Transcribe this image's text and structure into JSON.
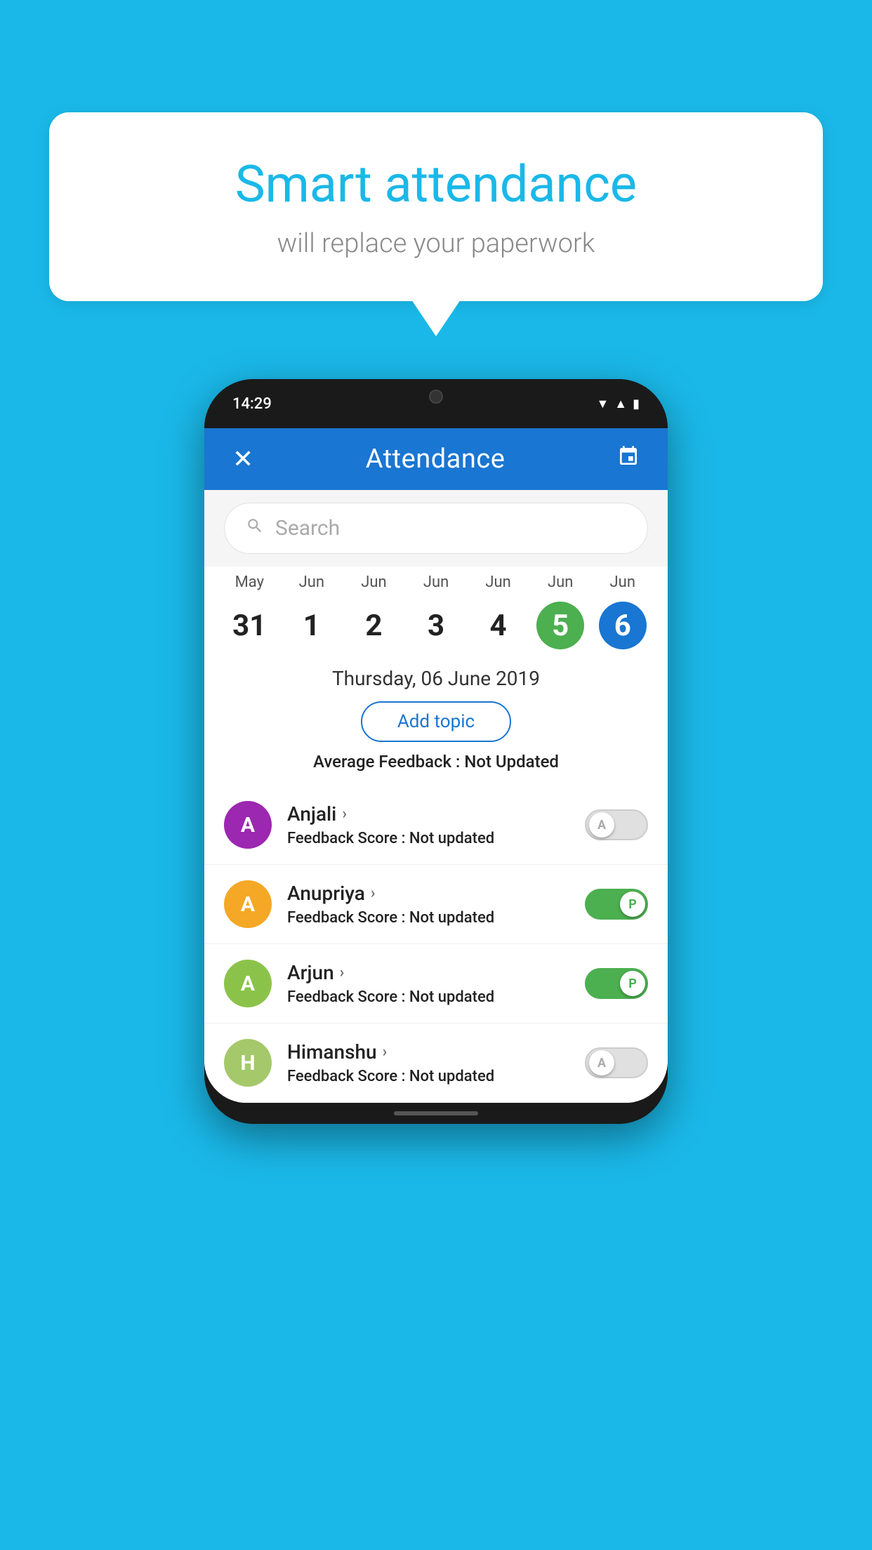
{
  "background_color": "#1ab8e8",
  "speech_bubble": {
    "title": "Smart attendance",
    "subtitle": "will replace your paperwork"
  },
  "phone": {
    "status_bar": {
      "time": "14:29"
    },
    "header": {
      "title": "Attendance",
      "close_icon": "✕",
      "calendar_icon": "📅"
    },
    "search": {
      "placeholder": "Search"
    },
    "calendar": {
      "columns": [
        {
          "month": "May",
          "day": "31",
          "style": "normal"
        },
        {
          "month": "Jun",
          "day": "1",
          "style": "normal"
        },
        {
          "month": "Jun",
          "day": "2",
          "style": "normal"
        },
        {
          "month": "Jun",
          "day": "3",
          "style": "normal"
        },
        {
          "month": "Jun",
          "day": "4",
          "style": "normal"
        },
        {
          "month": "Jun",
          "day": "5",
          "style": "today"
        },
        {
          "month": "Jun",
          "day": "6",
          "style": "selected"
        }
      ]
    },
    "selected_date_label": "Thursday, 06 June 2019",
    "add_topic_label": "Add topic",
    "feedback_label": "Average Feedback :",
    "feedback_value": "Not Updated",
    "students": [
      {
        "name": "Anjali",
        "avatar_letter": "A",
        "avatar_color": "#9c27b0",
        "feedback_label": "Feedback Score :",
        "feedback_value": "Not updated",
        "toggle_state": "off",
        "toggle_label": "A"
      },
      {
        "name": "Anupriya",
        "avatar_letter": "A",
        "avatar_color": "#f4a825",
        "feedback_label": "Feedback Score :",
        "feedback_value": "Not updated",
        "toggle_state": "on",
        "toggle_label": "P"
      },
      {
        "name": "Arjun",
        "avatar_letter": "A",
        "avatar_color": "#8bc34a",
        "feedback_label": "Feedback Score :",
        "feedback_value": "Not updated",
        "toggle_state": "on",
        "toggle_label": "P"
      },
      {
        "name": "Himanshu",
        "avatar_letter": "H",
        "avatar_color": "#a5c86b",
        "feedback_label": "Feedback Score :",
        "feedback_value": "Not updated",
        "toggle_state": "off",
        "toggle_label": "A"
      }
    ]
  }
}
